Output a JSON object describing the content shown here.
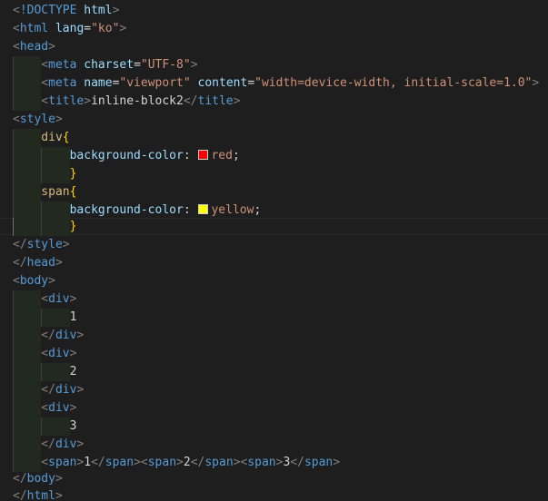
{
  "editor": {
    "lang": "html",
    "doctype": "!DOCTYPE",
    "doctype_kw": "html",
    "lang_attr": "lang",
    "lang_val": "\"ko\"",
    "meta_charset_attr": "charset",
    "meta_charset_val": "\"UTF-8\"",
    "meta_name_attr": "name",
    "meta_name_val": "\"viewport\"",
    "meta_content_attr": "content",
    "meta_content_val": "\"width=device-width, initial-scale=1.0\"",
    "title_text": "inline-block2",
    "css": {
      "selector_div": "div",
      "selector_span": "span",
      "property": "background-color",
      "value_red": "red",
      "value_yellow": "yellow",
      "swatch_red": "#ff0000",
      "swatch_yellow": "#ffff00"
    },
    "body_values": [
      "1",
      "2",
      "3"
    ],
    "span_line_values": [
      "1",
      "2",
      "3"
    ]
  }
}
